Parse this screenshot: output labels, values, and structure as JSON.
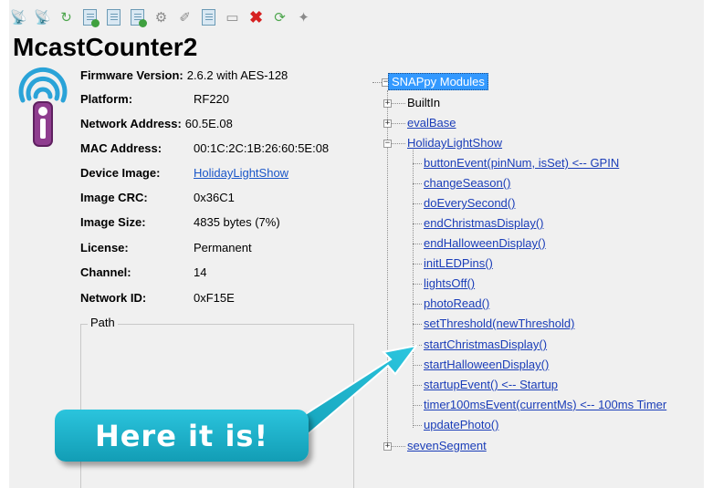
{
  "toolbar": {
    "icons": [
      "satellite-icon",
      "satellite-ping-icon",
      "refresh-icon",
      "upload-image-icon",
      "erase-image-icon",
      "snappy-image-icon",
      "settings-gear-icon",
      "wand-icon",
      "copy-icon",
      "console-icon",
      "delete-icon",
      "reboot-icon",
      "pin-icon"
    ]
  },
  "device": {
    "title": "McastCounter2",
    "fields": [
      {
        "label": "Firmware Version:",
        "value": "2.6.2 with AES-128"
      },
      {
        "label": "Platform:",
        "value": "RF220"
      },
      {
        "label": "Network Address:",
        "value": "60.5E.08"
      },
      {
        "label": "MAC Address:",
        "value": "00:1C:2C:1B:26:60:5E:08"
      },
      {
        "label": "Device Image:",
        "value": "HolidayLightShow"
      },
      {
        "label": "Image CRC:",
        "value": "0x36C1"
      },
      {
        "label": "Image Size:",
        "value": "4835 bytes (7%)"
      },
      {
        "label": "License:",
        "value": "Permanent"
      },
      {
        "label": "Channel:",
        "value": "14"
      },
      {
        "label": "Network ID:",
        "value": "0xF15E"
      }
    ],
    "path_label": "Path"
  },
  "tree": {
    "root": "SNAPpy Modules",
    "modules": [
      {
        "name": "BuiltIn",
        "expanded": false,
        "link": false
      },
      {
        "name": "evalBase",
        "expanded": false,
        "link": true
      },
      {
        "name": "HolidayLightShow",
        "expanded": true,
        "link": true
      },
      {
        "name": "sevenSegment",
        "expanded": false,
        "link": true
      }
    ],
    "functions": [
      "buttonEvent(pinNum, isSet) <-- GPIN",
      "changeSeason()",
      "doEverySecond()",
      "endChristmasDisplay()",
      "endHalloweenDisplay()",
      "initLEDPins()",
      "lightsOff()",
      "photoRead()",
      "setThreshold(newThreshold)",
      "startChristmasDisplay()",
      "startHalloweenDisplay()",
      "startupEvent() <-- Startup",
      "timer100msEvent(currentMs) <-- 100ms Timer",
      "updatePhoto()"
    ]
  },
  "callout": {
    "text": "Here it is!",
    "color": "#1fb5cf"
  }
}
